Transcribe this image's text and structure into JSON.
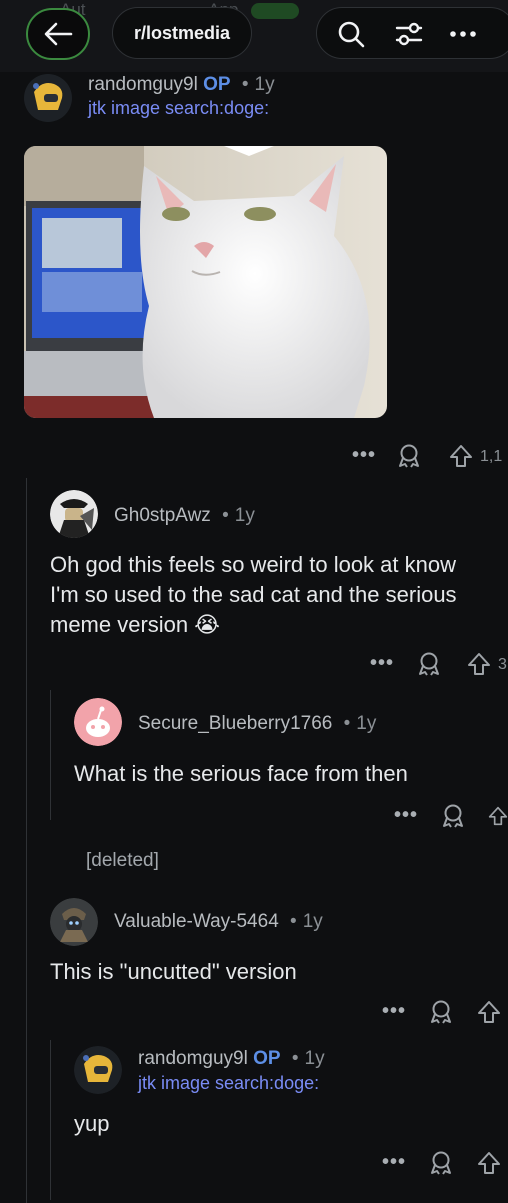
{
  "header": {
    "back_icon": "arrow-left-icon",
    "subreddit": "r/lostmedia",
    "ghost_text": [
      "Aut",
      "App"
    ],
    "search_icon": "search-icon",
    "filter_icon": "filter-icon",
    "more_icon": "more-icon"
  },
  "comments": [
    {
      "author": "randomguy9l",
      "op": "OP",
      "age": "1y",
      "flair": "jtk image search:doge:",
      "image_alt": "white cat photo",
      "actions": {
        "count": "1,1"
      }
    },
    {
      "author": "Gh0stpAwz",
      "age": "1y",
      "lines": [
        "Oh god this feels so weird to look at know",
        "I'm so used to the sad cat and the serious",
        "meme version"
      ],
      "emoji": "😭",
      "actions": {
        "count": "3"
      }
    },
    {
      "author": "Secure_Blueberry1766",
      "age": "1y",
      "text": "What is the serious face from then"
    },
    {
      "author": "[deleted]"
    },
    {
      "author": "Valuable-Way-5464",
      "age": "1y",
      "text": "This is \"uncutted\" version"
    },
    {
      "author": "randomguy9l",
      "op": "OP",
      "age": "1y",
      "flair": "jtk image search:doge:",
      "text": "yup"
    }
  ],
  "separator": "•",
  "colors": {
    "background": "#0e0f11",
    "op_blue": "#5d8fe6",
    "flair_purple": "#7a8cf5",
    "back_ring_green": "#3b8a3f"
  }
}
